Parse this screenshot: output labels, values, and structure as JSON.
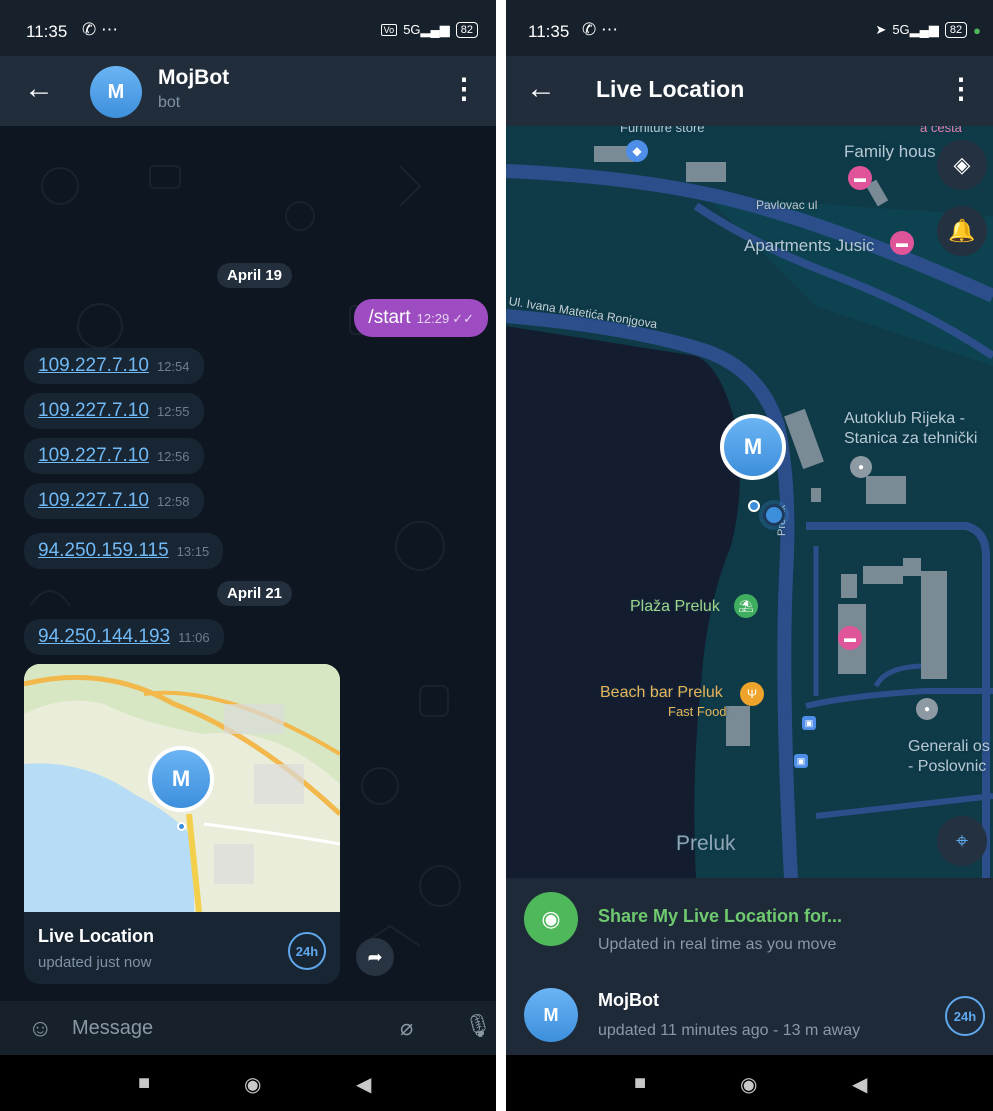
{
  "left": {
    "status": {
      "time": "11:35",
      "battery": "82"
    },
    "header": {
      "avatar_letter": "M",
      "name": "MojBot",
      "subtitle": "bot"
    },
    "dates": {
      "d1": "April 19",
      "d2": "April 21"
    },
    "outgoing": {
      "text": "/start",
      "time": "12:29"
    },
    "messages": [
      {
        "text": "109.227.7.10",
        "time": "12:54"
      },
      {
        "text": "109.227.7.10",
        "time": "12:55"
      },
      {
        "text": "109.227.7.10",
        "time": "12:56"
      },
      {
        "text": "109.227.7.10",
        "time": "12:58"
      },
      {
        "text": "94.250.159.115",
        "time": "13:15"
      },
      {
        "text": "94.250.144.193",
        "time": "11:06"
      }
    ],
    "location_card": {
      "avatar_letter": "M",
      "title": "Live Location",
      "subtitle": "updated just now",
      "badge": "24h"
    },
    "input": {
      "placeholder": "Message"
    }
  },
  "right": {
    "status": {
      "time": "11:35",
      "battery": "82"
    },
    "header": {
      "title": "Live Location"
    },
    "map": {
      "marker_letter": "M",
      "labels": {
        "furniture": "Furniture store",
        "family": "Family hous",
        "cesta": "a cesta",
        "pavlovac": "Pavlovac ul",
        "apartments": "Apartments Jusic",
        "ivana": "Ul. Ivana Matetića Ronjgova",
        "autoklub1": "Autoklub Rijeka -",
        "autoklub2": "Stanica za tehnički",
        "preluk_road": "Preluk",
        "plaza": "Plaža Preluk",
        "beachbar": "Beach bar Preluk",
        "fastfood": "Fast Food",
        "generali1": "Generali os",
        "generali2": "- Poslovnic",
        "preluk": "Preluk"
      }
    },
    "share": {
      "title": "Share My Live Location for...",
      "subtitle": "Updated in real time as you move"
    },
    "contact": {
      "avatar_letter": "M",
      "name": "MojBot",
      "subtitle": "updated 11 minutes ago - 13 m away",
      "badge": "24h"
    }
  },
  "colors": {
    "accent": "#5288c1",
    "outgoing_bubble": "#9d4cc2",
    "link": "#71baf5",
    "green": "#4fb85a"
  }
}
